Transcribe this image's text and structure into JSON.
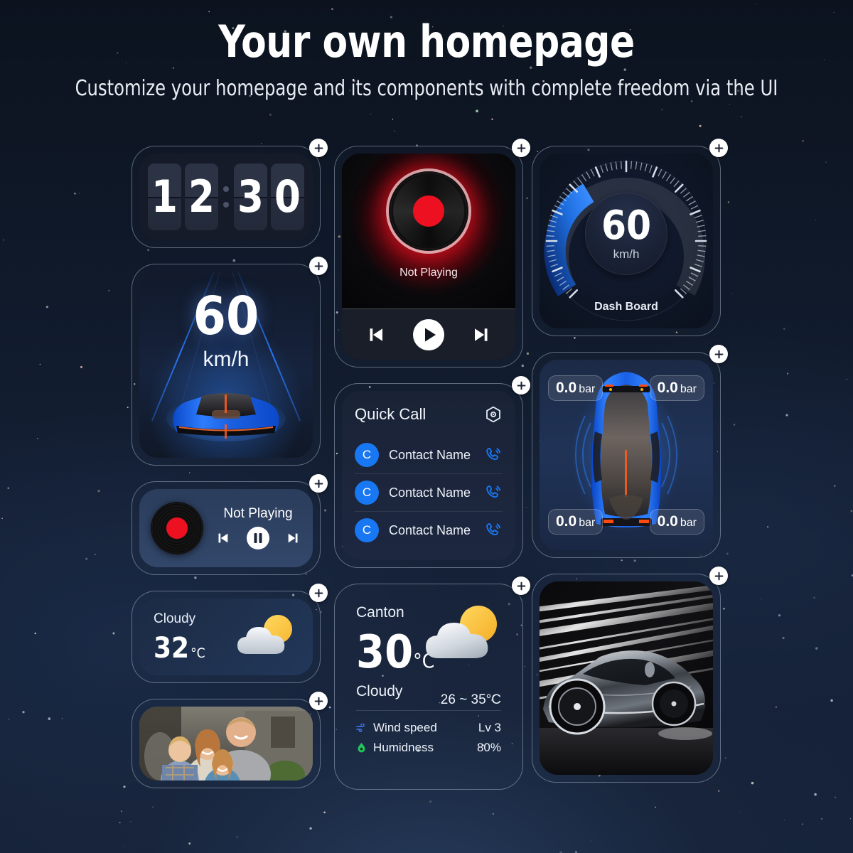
{
  "header": {
    "title": "Your own homepage",
    "subtitle": "Customize your homepage and its components with complete freedom via the UI"
  },
  "add_label": "+",
  "theme": {
    "accent_blue": "#1877f2",
    "gauge_blue": "#1f6fe0",
    "vinyl_red": "#ec1020",
    "background": "#101a2b",
    "card_border": "#bac9e0"
  },
  "widgets": {
    "clock": {
      "name": "Flip Clock",
      "digits": [
        "1",
        "2",
        "3",
        "0"
      ],
      "time": "12:30"
    },
    "music_large": {
      "name": "Music Player",
      "status": "Not Playing",
      "controls": [
        "previous-track",
        "play",
        "next-track"
      ]
    },
    "dashboard": {
      "name": "Dash Board",
      "value": "60",
      "unit": "km/h",
      "label": "Dash Board",
      "arc_percent": 22
    },
    "hud": {
      "name": "Head Up Display",
      "value": "60",
      "unit": "km/h"
    },
    "quick_call": {
      "title": "Quick Call",
      "settings_icon": "hex-gear-icon",
      "contacts": [
        {
          "initial": "C",
          "name": "Contact Name",
          "action": "call-icon"
        },
        {
          "initial": "C",
          "name": "Contact Name",
          "action": "call-icon"
        },
        {
          "initial": "C",
          "name": "Contact Name",
          "action": "call-icon"
        }
      ]
    },
    "tire_pressure": {
      "name": "Tire Pressure",
      "front_left": {
        "value": "0.0",
        "unit": "bar"
      },
      "front_right": {
        "value": "0.0",
        "unit": "bar"
      },
      "rear_left": {
        "value": "0.0",
        "unit": "bar"
      },
      "rear_right": {
        "value": "0.0",
        "unit": "bar"
      }
    },
    "music_small": {
      "name": "Mini Music Player",
      "status": "Not Playing",
      "controls": [
        "previous-track",
        "pause",
        "next-track"
      ]
    },
    "weather_small": {
      "condition": "Cloudy",
      "temperature": "32",
      "unit": "°C",
      "icon": "sun-behind-cloud-icon"
    },
    "weather_large": {
      "city": "Canton",
      "temperature": "30",
      "unit": "°C",
      "range": "26 ~ 35°C",
      "condition": "Cloudy",
      "icon": "sun-behind-cloud-icon",
      "details": [
        {
          "icon": "wind-icon",
          "label": "Wind speed",
          "value": "Lv 3"
        },
        {
          "icon": "humidity-icon",
          "label": "Humidness",
          "value": "80%"
        }
      ]
    },
    "photo_family": {
      "name": "Family Photo",
      "alt": "family-photo"
    },
    "photo_car": {
      "name": "Car Photo",
      "alt": "sports-car-photo"
    }
  }
}
